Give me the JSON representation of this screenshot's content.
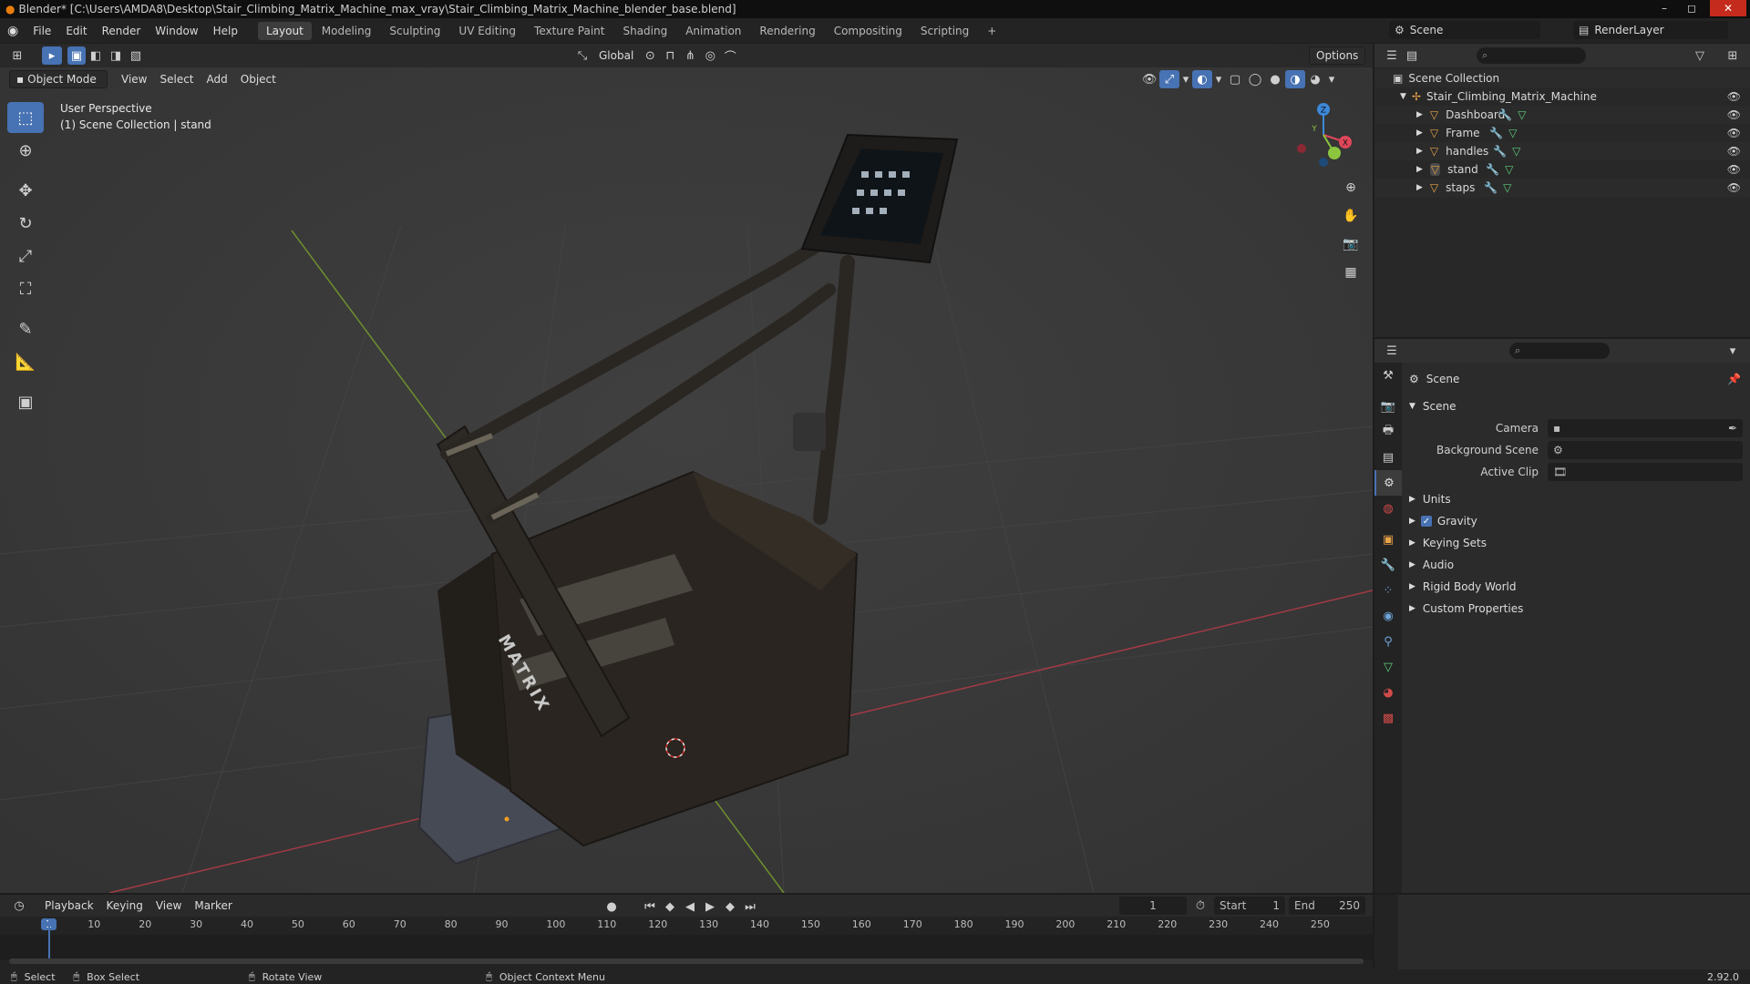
{
  "titlebar": {
    "title": "Blender* [C:\\Users\\AMDA8\\Desktop\\Stair_Climbing_Matrix_Machine_max_vray\\Stair_Climbing_Matrix_Machine_blender_base.blend]",
    "min": "–",
    "max": "◻",
    "close": "✕"
  },
  "menu": [
    "File",
    "Edit",
    "Render",
    "Window",
    "Help"
  ],
  "workspaces": [
    "Layout",
    "Modeling",
    "Sculpting",
    "UV Editing",
    "Texture Paint",
    "Shading",
    "Animation",
    "Rendering",
    "Compositing",
    "Scripting"
  ],
  "workspace_add": "+",
  "scene_selector": "Scene",
  "renderlayer_selector": "RenderLayer",
  "viewport": {
    "transform_orientation": "Global",
    "options": "Options",
    "mode": "Object Mode",
    "menus": [
      "View",
      "Select",
      "Add",
      "Object"
    ],
    "info_line1": "User Perspective",
    "info_line2": "(1) Scene Collection | stand",
    "gizmo": {
      "z": "Z",
      "y": "Y",
      "x": "X"
    },
    "brand_text": "MATRIX"
  },
  "outliner": {
    "root": "Scene Collection",
    "collection": "Stair_Climbing_Matrix_Machine",
    "objects": [
      "Dashboard",
      "Frame",
      "handles",
      "stand",
      "staps"
    ]
  },
  "properties": {
    "context": "Scene",
    "panel": "Scene",
    "fields": [
      {
        "label": "Camera",
        "value": ""
      },
      {
        "label": "Background Scene",
        "value": ""
      },
      {
        "label": "Active Clip",
        "value": ""
      }
    ],
    "subpanels": [
      "Units",
      "Gravity",
      "Keying Sets",
      "Audio",
      "Rigid Body World",
      "Custom Properties"
    ],
    "gravity_checked": true
  },
  "timeline": {
    "menus": [
      "Playback",
      "Keying",
      "View",
      "Marker"
    ],
    "current_frame": "1",
    "start_label": "Start",
    "start_value": "1",
    "end_label": "End",
    "end_value": "250",
    "ticks": [
      "1",
      "10",
      "20",
      "30",
      "40",
      "50",
      "60",
      "70",
      "80",
      "90",
      "100",
      "110",
      "120",
      "130",
      "140",
      "150",
      "160",
      "170",
      "180",
      "190",
      "200",
      "210",
      "220",
      "230",
      "240",
      "250"
    ]
  },
  "statusbar": {
    "select": "Select",
    "box_select": "Box Select",
    "rotate": "Rotate View",
    "context_menu": "Object Context Menu",
    "version": "2.92.0"
  },
  "colors": {
    "accent": "#4772b3",
    "x_axis": "#e0475a",
    "y_axis": "#8cc63f",
    "z_axis": "#3d88d8"
  }
}
